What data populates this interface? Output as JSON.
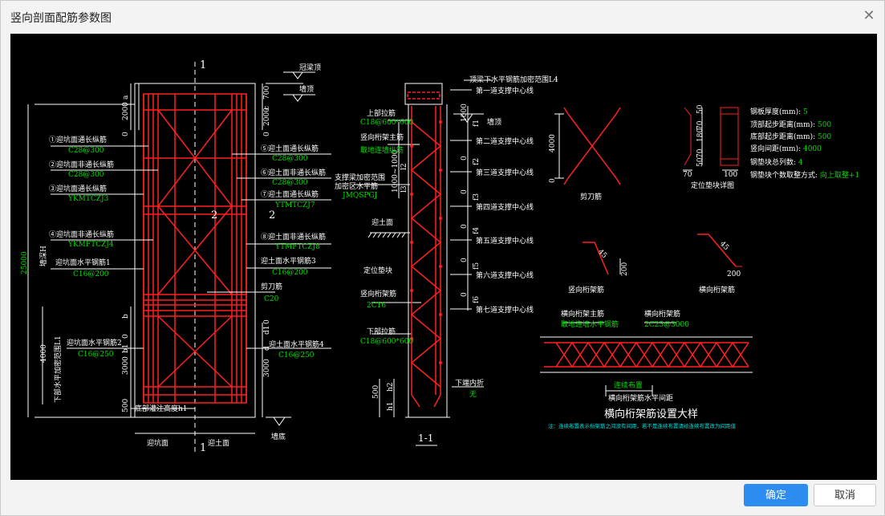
{
  "dialog": {
    "title": "竖向剖面配筋参数图",
    "ok_label": "确定",
    "cancel_label": "取消"
  },
  "colors": {
    "background": "#000000",
    "rebar": "#ff2020",
    "label": "#ffffff",
    "spec": "#00dd00",
    "note": "#00e0e0",
    "primary_button": "#2d8cf0"
  },
  "left_section": {
    "section_mark_top": "1",
    "section_mark_bottom": "1",
    "section2_left": "2",
    "section2_right": "2",
    "crown_top": "冠梁顶",
    "wall_top": "墙顶",
    "wall_bottom": "墙底",
    "pit_face": "迎坑面",
    "soil_face": "迎土面",
    "bottom_pour": "底部灌注高度h1",
    "dims": {
      "total": "25000",
      "wall_depth": "墙深H",
      "d2000_left": "2000",
      "a": "a",
      "zero_top_left": "0",
      "d2000_right": "2000",
      "c": "c",
      "d700": "700",
      "zero_top_right": "0",
      "b_left": "b",
      "d3000_left": "3000",
      "zero_mid_left": "0",
      "b1": "b1",
      "d1": "d1",
      "zero_mid_right": "0",
      "d3000_right": "3000",
      "d": "d",
      "d500": "500",
      "d4000": "4000",
      "lower_dense": "下部水平加密范围L1"
    },
    "left_labels": [
      {
        "name": "①迎坑面通长纵筋",
        "spec": "C28@300"
      },
      {
        "name": "②迎坑面非通长纵筋",
        "spec": "C28@300"
      },
      {
        "name": "③迎坑面通长纵筋",
        "spec": "YKMTCZJ3"
      },
      {
        "name": "④迎坑面非通长纵筋",
        "spec": "YKMFTCZJ4"
      },
      {
        "name": "迎坑面水平钢筋1",
        "spec": "C16@200"
      },
      {
        "name": "迎坑面水平钢筋2",
        "spec": "C16@250"
      }
    ],
    "right_labels": [
      {
        "name": "⑤迎土面通长纵筋",
        "spec": "C28@300"
      },
      {
        "name": "⑥迎土面非通长纵筋",
        "spec": "C28@300"
      },
      {
        "name": "⑦迎土面通长纵筋",
        "spec": "YTMTCZJ7"
      },
      {
        "name": "⑧迎土面非通长纵筋",
        "spec": "YTMFTCZJ8"
      },
      {
        "name": "迎土面水平钢筋3",
        "spec": "C16@200"
      },
      {
        "name": "剪刀筋",
        "spec": "C20"
      },
      {
        "name": "迎土面水平钢筋4",
        "spec": "C16@250"
      }
    ]
  },
  "middle_section": {
    "title": "1-1",
    "top_dense": "顶梁下水平钢筋加密范围L4",
    "wall_top": "墙顶",
    "support_lines": [
      "第一道支撑中心线",
      "第二道支撑中心线",
      "第三道支撑中心线",
      "第四道支撑中心线",
      "第五道支撑中心线",
      "第六道支撑中心线",
      "第七道支撑中心线"
    ],
    "f_labels": [
      "f1",
      "f2",
      "f3",
      "f4",
      "f5",
      "f6"
    ],
    "zeros": "0",
    "d1000": "1000",
    "d500": "500",
    "l2": "l2",
    "l3": "l3",
    "range": "1000~1000",
    "h1": "h1",
    "h2": "h2",
    "upper_tie": {
      "name": "上部拉筋",
      "spec": "C18@600*600"
    },
    "truss_main": {
      "name": "竖向桁架主筋",
      "spec": "取地连墙纵筋"
    },
    "support_dense": {
      "name": "支撑梁加密范围",
      "name2": "加密区水平筋",
      "spec": "JMQSPGJ"
    },
    "soil_face": "迎土面",
    "spacer": "定位垫块",
    "vert_truss": {
      "name": "竖向桁架筋",
      "spec": "2C16"
    },
    "lower_tie": {
      "name": "下部拉筋",
      "spec": "C18@600*600"
    },
    "bottom_fold": {
      "name": "下端内折",
      "spec": "无"
    }
  },
  "right_panel": {
    "scissor_label": "剪刀筋",
    "d4000": "4000",
    "zero": "0",
    "spacer_title": "定位垫块详图",
    "spacer_dims": [
      "50",
      "70",
      "180",
      "70",
      "50",
      "70",
      "100"
    ],
    "params": [
      {
        "label": "钢板厚度(mm): ",
        "value": "5"
      },
      {
        "label": "顶部起步距离(mm): ",
        "value": "500"
      },
      {
        "label": "底部起步距离(mm): ",
        "value": "500"
      },
      {
        "label": "竖向间距(mm): ",
        "value": "4000"
      },
      {
        "label": "钢垫块总列数: ",
        "value": "4"
      },
      {
        "label": "钢垫块个数取整方式: ",
        "value": "向上取整+1"
      }
    ],
    "vert_truss_label": "竖向桁架筋",
    "horiz_truss_label": "横向桁架筋",
    "bend_45": "45",
    "d200": "200",
    "horiz_main": {
      "name": "横向桁架主筋",
      "spec": "取地连墙水平钢筋"
    },
    "horiz_bar": {
      "name": "横向桁架筋",
      "spec": "2C25@3000"
    },
    "continuous": "连续布置",
    "spacing": "横向桁架筋水平间距",
    "detail_title": "横向桁架筋设置大样",
    "note": "注：连续布置表示桁架筋之间没有间距，若不是连续布置请给连续布置改为间距值"
  }
}
